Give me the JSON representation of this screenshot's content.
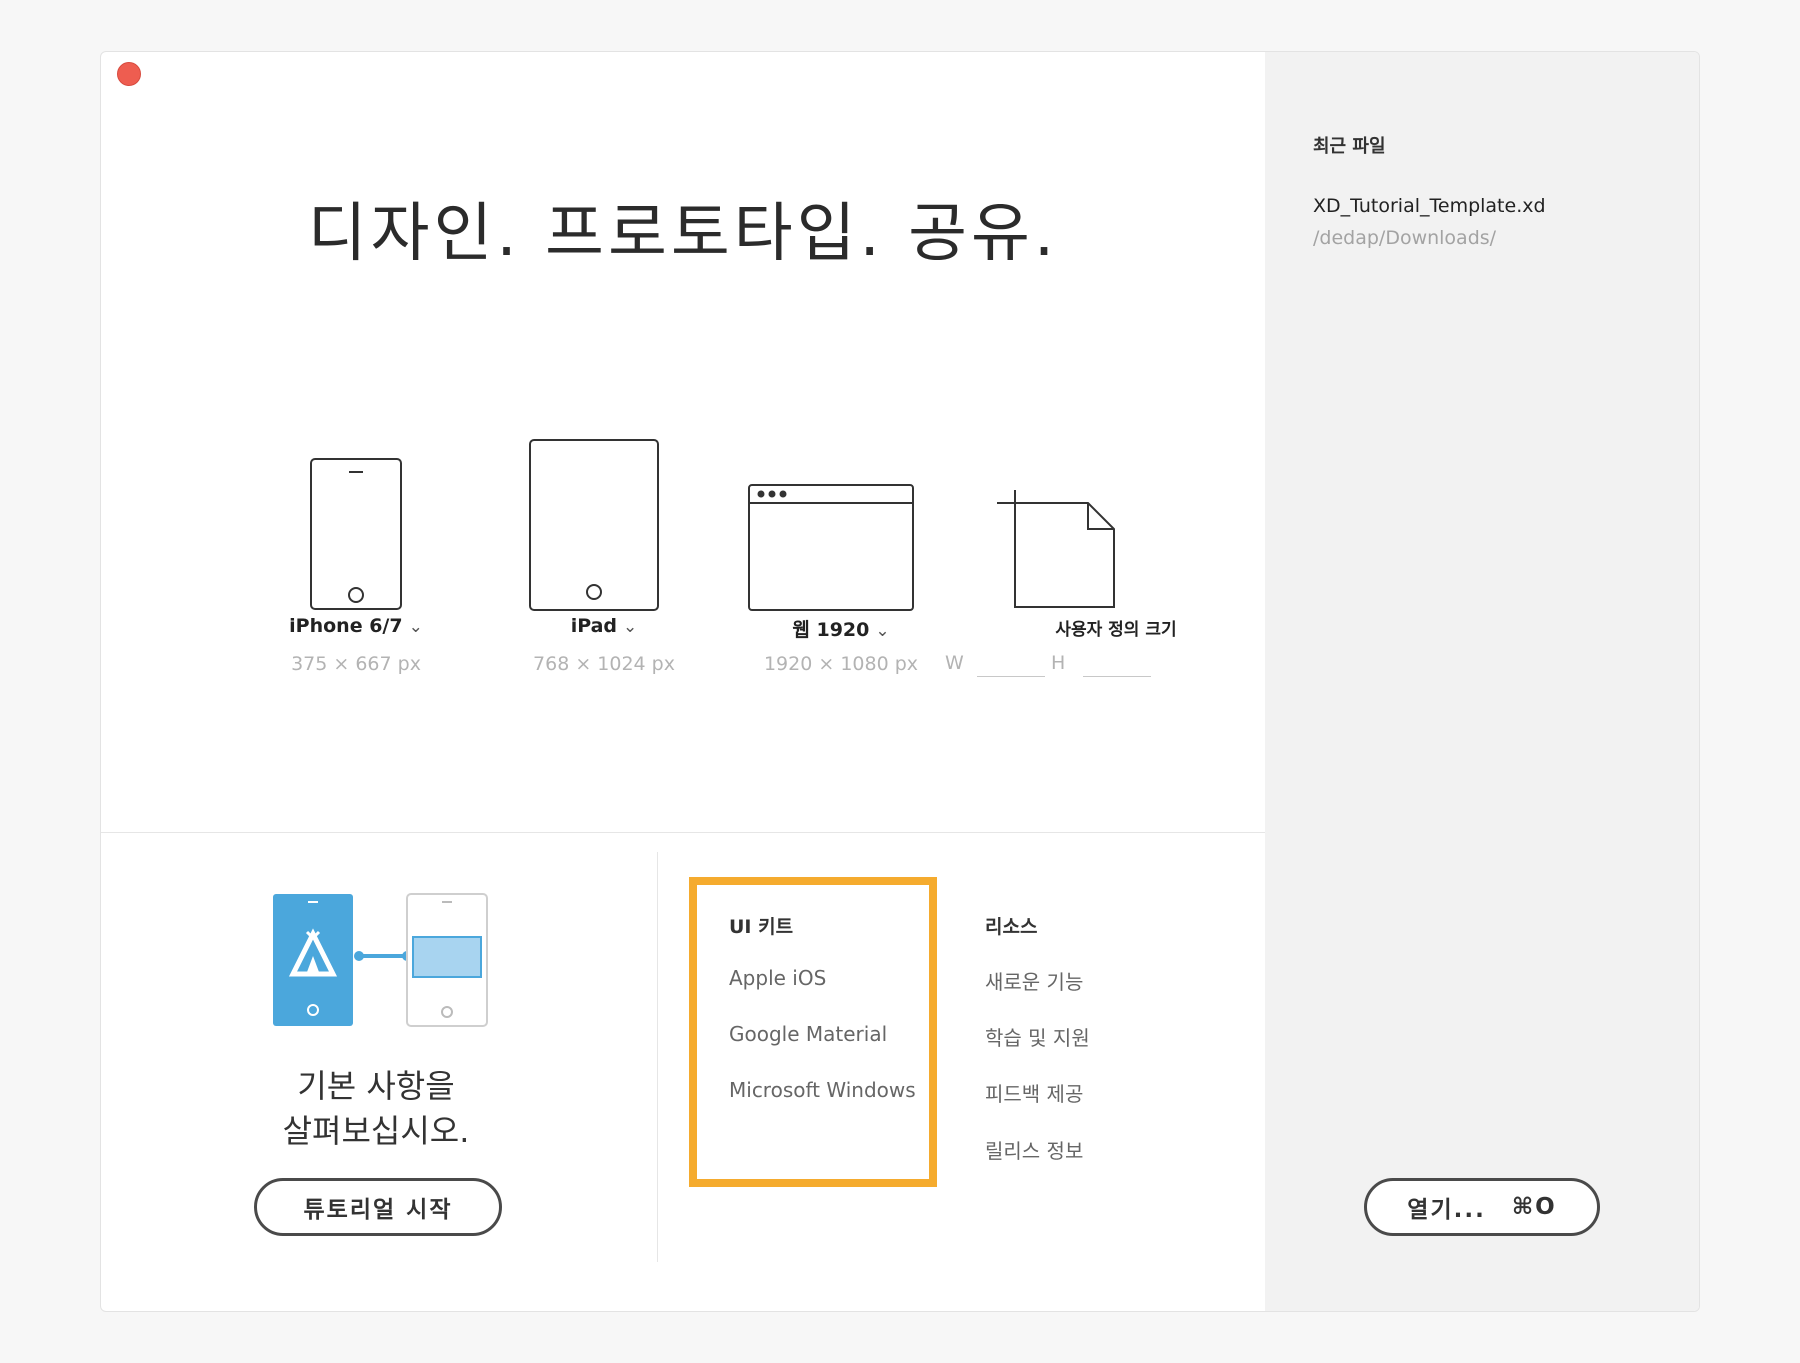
{
  "headline": "디자인. 프로토타입. 공유.",
  "presets": [
    {
      "name": "iPhone 6/7",
      "size": "375 × 667 px"
    },
    {
      "name": "iPad",
      "size": "768 × 1024 px"
    },
    {
      "name": "웹 1920",
      "size": "1920 × 1080 px"
    }
  ],
  "custom": {
    "name": "사용자 정의 크기",
    "w_label": "W",
    "h_label": "H"
  },
  "tutorial": {
    "line1": "기본 사항을",
    "line2": "살펴보십시오.",
    "button": "튜토리얼 시작"
  },
  "ui_kits": {
    "title": "UI 키트",
    "items": [
      "Apple iOS",
      "Google Material",
      "Microsoft Windows"
    ]
  },
  "resources": {
    "title": "리소스",
    "items": [
      "새로운 기능",
      "학습 및 지원",
      "피드백 제공",
      "릴리스 정보"
    ]
  },
  "recent": {
    "title": "최근 파일",
    "file": "XD_Tutorial_Template.xd",
    "path": "/dedap/Downloads/"
  },
  "open_button": {
    "label": "열기...",
    "shortcut": "⌘O"
  },
  "colors": {
    "close": "#ee5d50",
    "highlight": "#f5ab2e",
    "tutorial_blue": "#4ba7dc"
  },
  "icons": [
    "close-icon",
    "iphone-icon",
    "ipad-icon",
    "browser-window-icon",
    "custom-size-icon",
    "chevron-down-icon",
    "tutorial-illustration"
  ]
}
